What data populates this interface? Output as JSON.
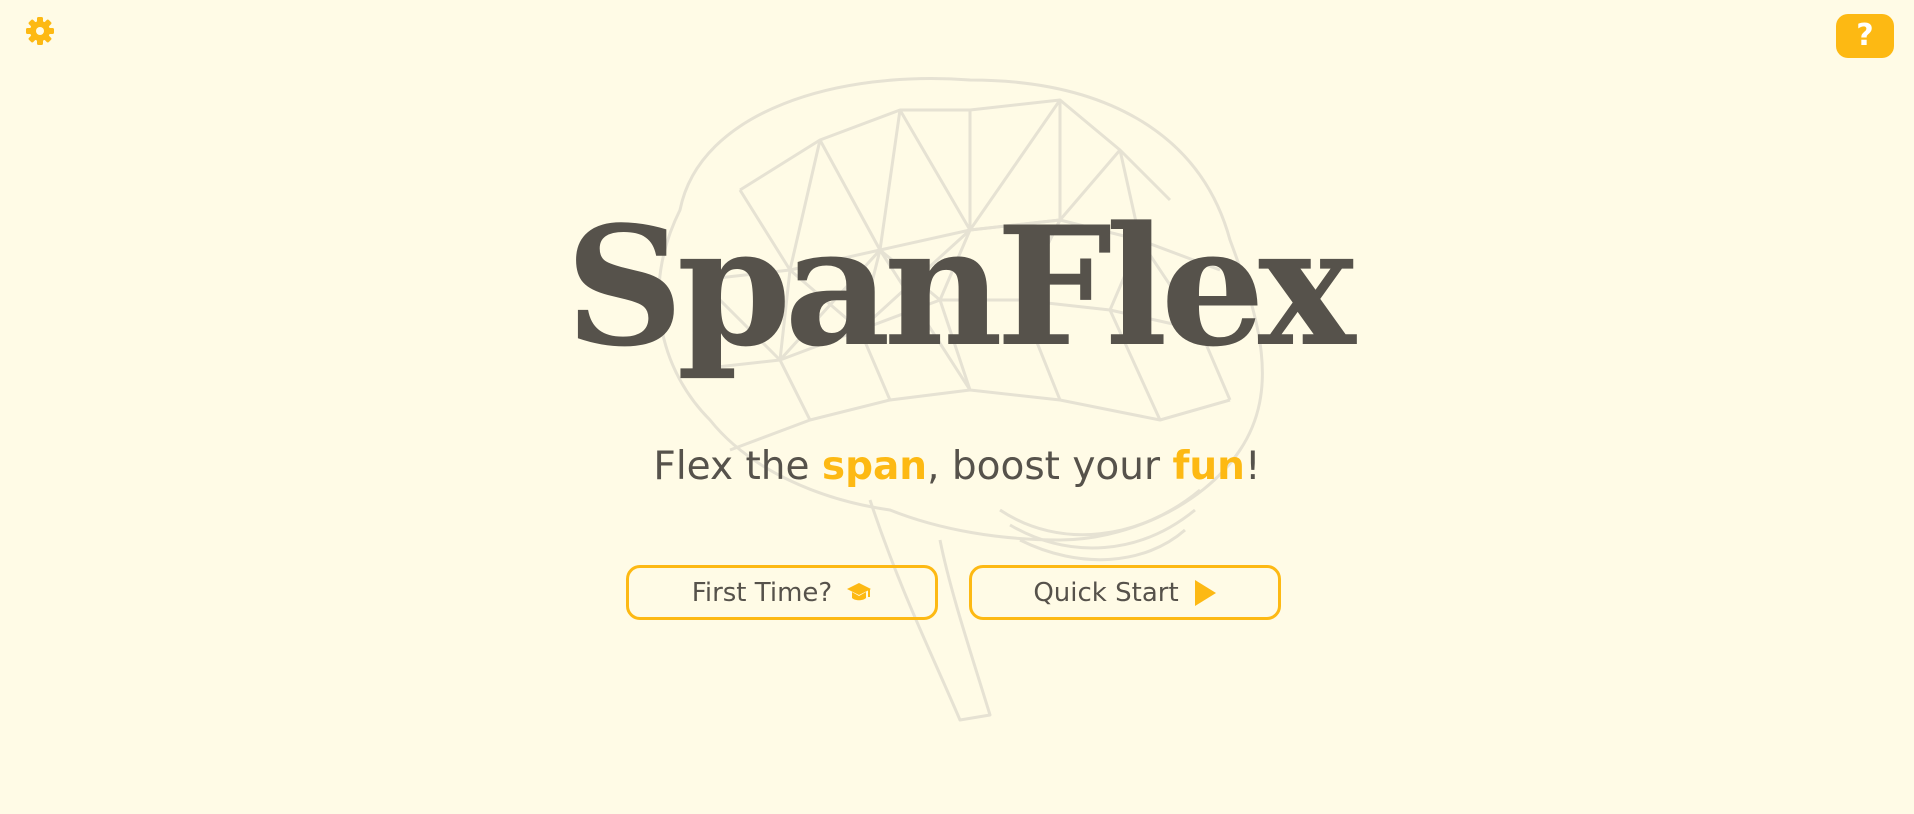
{
  "app": {
    "title": "SpanFlex"
  },
  "tagline": {
    "part1": "Flex the ",
    "highlight1": "span",
    "part2": ", boost your ",
    "highlight2": "fun",
    "part3": "!"
  },
  "buttons": {
    "first_time_label": "First Time?",
    "quick_start_label": "Quick Start"
  },
  "help": {
    "label": "?"
  },
  "icons": {
    "settings": "gear-icon",
    "help": "question-icon",
    "first_time": "graduation-cap-icon",
    "quick_start": "play-icon",
    "background": "brain-illustration"
  },
  "colors": {
    "background": "#fffbe6",
    "accent": "#fdb913",
    "text": "#56524b",
    "brain_lines": "#e6e2d3"
  }
}
